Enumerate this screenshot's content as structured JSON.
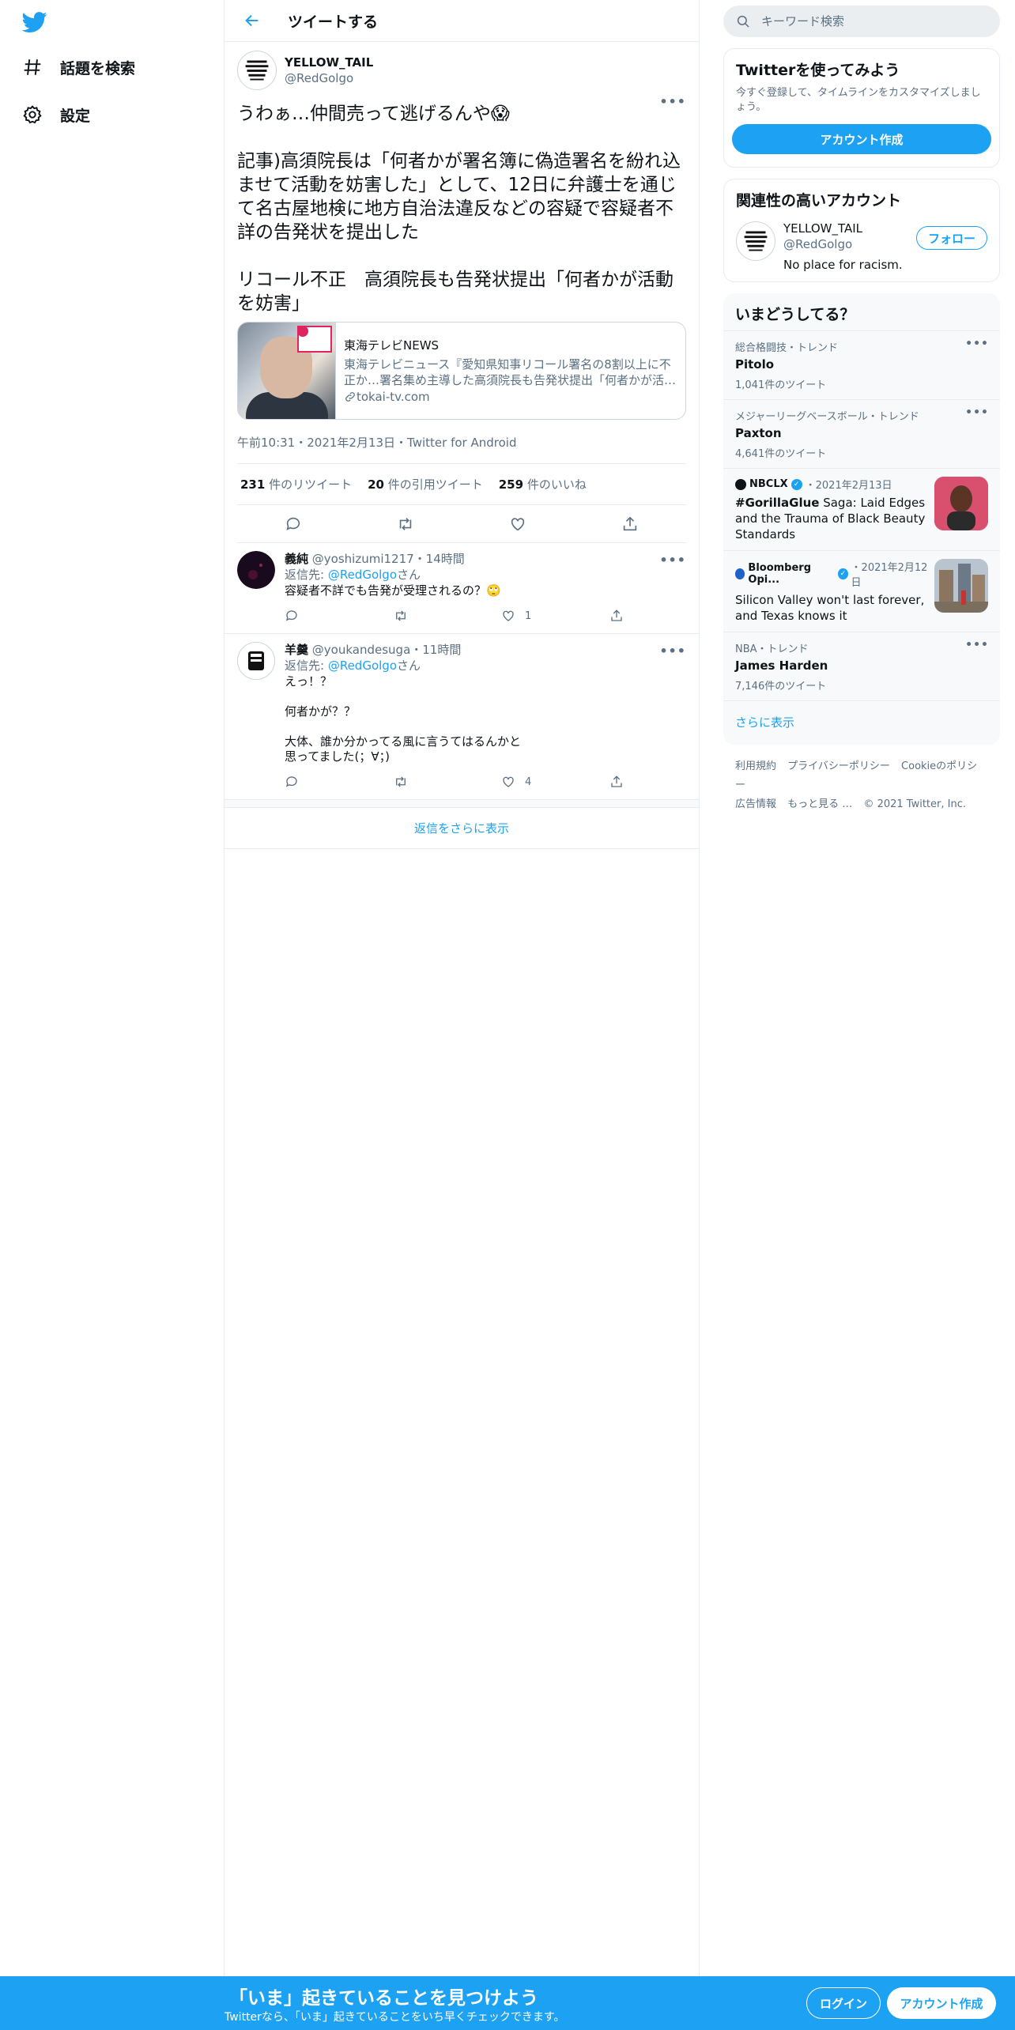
{
  "colors": {
    "accent": "#1da1f2",
    "text": "#0f1419",
    "secondary": "#5b7083",
    "border": "#e6ecf0"
  },
  "nav": {
    "items": [
      {
        "icon": "hashtag-icon",
        "label": "話題を検索"
      },
      {
        "icon": "gear-icon",
        "label": "設定"
      }
    ]
  },
  "header": {
    "title": "ツイートする"
  },
  "tweet": {
    "name": "YELLOW_TAIL",
    "handle": "@RedGolgo",
    "text": "うわぁ…仲間売って逃げるんや😱\n\n記事)高須院長は「何者かが署名簿に偽造署名を紛れ込ませて活動を妨害した」として、12日に弁護士を通じて名古屋地検に地方自治法違反などの容疑で容疑者不詳の告発状を提出した\n\nリコール不正　高須院長も告発状提出「何者かが活動を妨害」",
    "card": {
      "title": "東海テレビNEWS",
      "description": "東海テレビニュース『愛知県知事リコール署名の8割以上に不正か…署名集め主導した高須院長も告発状提出「何者かが活…",
      "domain": "tokai-tv.com"
    },
    "meta": "午前10:31・2021年2月13日・Twitter for Android",
    "stats": {
      "retweets_num": "231",
      "retweets_label": " 件のリツイート",
      "quotes_num": "20",
      "quotes_label": " 件の引用ツイート",
      "likes_num": "259",
      "likes_label": " 件のいいね"
    }
  },
  "replies": [
    {
      "name": "義純",
      "handle": "@yoshizumi1217・14時間",
      "reply_prefix": "返信先: ",
      "mention": "@RedGolgo",
      "mention_suffix": "さん",
      "text": "容疑者不詳でも告発が受理されるの？🙄",
      "reply_count": "",
      "retweet_count": "",
      "like_count": "1"
    },
    {
      "name": "羊羹",
      "handle": "@youkandesuga・11時間",
      "reply_prefix": "返信先: ",
      "mention": "@RedGolgo",
      "mention_suffix": "さん",
      "text": "えっ！？\n\n何者かが？？\n\n大体、誰か分かってる風に言うてはるんかと\n思ってました(；∀；)",
      "reply_count": "",
      "retweet_count": "",
      "like_count": "4"
    }
  ],
  "show_more_replies": "返信をさらに表示",
  "search": {
    "placeholder": "キーワード検索"
  },
  "signup_panel": {
    "title": "Twitterを使ってみよう",
    "subtitle": "今すぐ登録して、タイムラインをカスタマイズしましょう。",
    "button": "アカウント作成"
  },
  "related": {
    "title": "関連性の高いアカウント",
    "account": {
      "name": "YELLOW_TAIL",
      "handle": "@RedGolgo",
      "bio": "No place for racism.",
      "follow": "フォロー"
    }
  },
  "trends": {
    "title": "いまどうしてる？",
    "items": [
      {
        "context": "総合格闘技・トレンド",
        "name": "Pitolo",
        "count": "1,041件のツイート"
      },
      {
        "context": "メジャーリーグベースボール・トレンド",
        "name": "Paxton",
        "count": "4,641件のツイート"
      }
    ],
    "news": [
      {
        "source": "NBCLX",
        "date": "・2021年2月13日",
        "title_bold": "#GorillaGlue",
        "title": " Saga: Laid Edges and the Trauma of Black Beauty Standards"
      },
      {
        "source": "Bloomberg Opi...",
        "date": "・2021年2月12日",
        "title_bold": "",
        "title": "Silicon Valley won't last forever, and Texas knows it"
      }
    ],
    "last": {
      "context": "NBA・トレンド",
      "name": "James Harden",
      "count": "7,146件のツイート"
    },
    "show_more": "さらに表示"
  },
  "footer": {
    "links": [
      "利用規約",
      "プライバシーポリシー",
      "Cookieのポリシー",
      "広告情報",
      "もっと見る …",
      "© 2021 Twitter, Inc."
    ]
  },
  "bottom_bar": {
    "title": "「いま」起きていることを見つけよう",
    "subtitle": "Twitterなら、「いま」起きていることをいち早くチェックできます。",
    "login": "ログイン",
    "signup": "アカウント作成"
  }
}
